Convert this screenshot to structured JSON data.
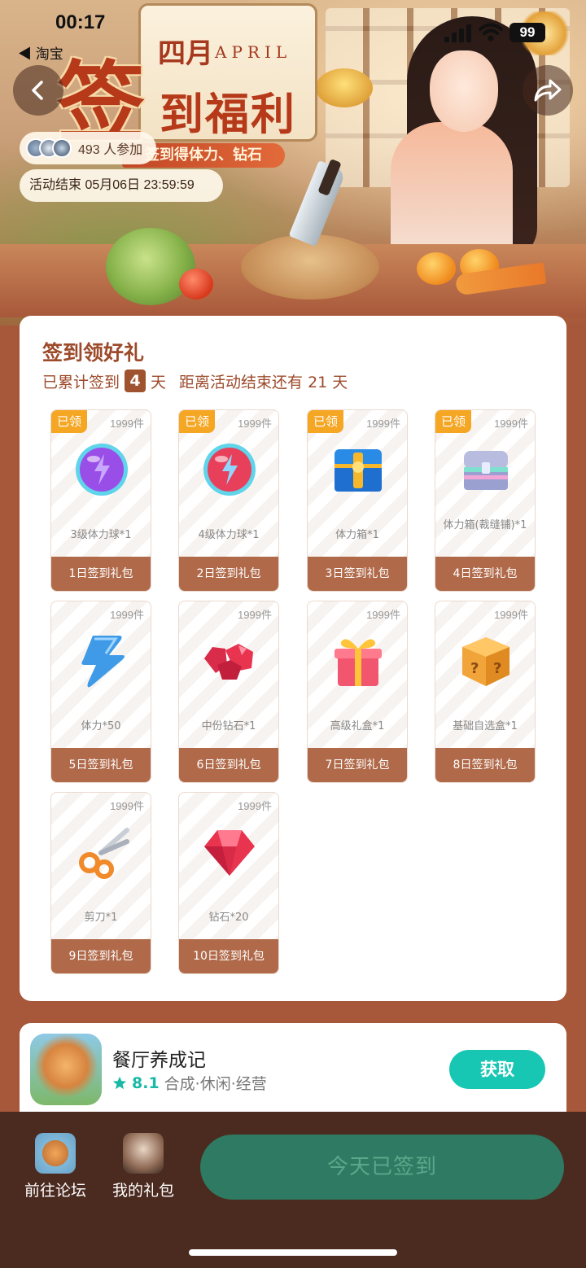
{
  "status_bar": {
    "time": "00:17",
    "back_app": "◀ 淘宝",
    "battery": "99"
  },
  "banner": {
    "month_cn": "四月",
    "month_en": "APRIL",
    "title_big": "签",
    "title_rest": "到福利",
    "ribbon": "签到得体力、钻石",
    "participants": "493 人参加",
    "end_time": "活动结束 05月06日 23:59:59"
  },
  "checkin": {
    "title": "签到领好礼",
    "progress_prefix": "已累计签到",
    "days_signed": "4",
    "progress_unit": "天",
    "remaining_text": "距离活动结束还有 21 天",
    "claimed_label": "已领",
    "gifts": [
      {
        "stock": "1999件",
        "name": "3级体力球*1",
        "day": "1日签到礼包",
        "claimed": true,
        "icon": "purple-energy-orb-icon"
      },
      {
        "stock": "1999件",
        "name": "4级体力球*1",
        "day": "2日签到礼包",
        "claimed": true,
        "icon": "red-energy-orb-icon"
      },
      {
        "stock": "1999件",
        "name": "体力箱*1",
        "day": "3日签到礼包",
        "claimed": true,
        "icon": "blue-chest-icon"
      },
      {
        "stock": "1999件",
        "name": "体力箱(裁缝铺)*1",
        "day": "4日签到礼包",
        "claimed": true,
        "icon": "silver-chest-icon"
      },
      {
        "stock": "1999件",
        "name": "体力*50",
        "day": "5日签到礼包",
        "claimed": false,
        "icon": "lightning-icon"
      },
      {
        "stock": "1999件",
        "name": "中份钻石*1",
        "day": "6日签到礼包",
        "claimed": false,
        "icon": "ruby-cluster-icon"
      },
      {
        "stock": "1999件",
        "name": "高级礼盒*1",
        "day": "7日签到礼包",
        "claimed": false,
        "icon": "gift-box-icon"
      },
      {
        "stock": "1999件",
        "name": "基础自选盒*1",
        "day": "8日签到礼包",
        "claimed": false,
        "icon": "mystery-box-icon"
      },
      {
        "stock": "1999件",
        "name": "剪刀*1",
        "day": "9日签到礼包",
        "claimed": false,
        "icon": "scissors-icon"
      },
      {
        "stock": "1999件",
        "name": "钻石*20",
        "day": "10日签到礼包",
        "claimed": false,
        "icon": "diamond-icon"
      }
    ]
  },
  "app": {
    "name": "餐厅养成记",
    "rating": "8.1",
    "tags": "合成·休闲·经营",
    "get_label": "获取"
  },
  "bottom_bar": {
    "forum_label": "前往论坛",
    "gifts_label": "我的礼包",
    "checked_label": "今天已签到"
  },
  "colors": {
    "brand_brown": "#a0532f",
    "claimed_badge": "#f5a623",
    "get_button": "#18c7b3",
    "checked_button": "#2f7a62"
  }
}
